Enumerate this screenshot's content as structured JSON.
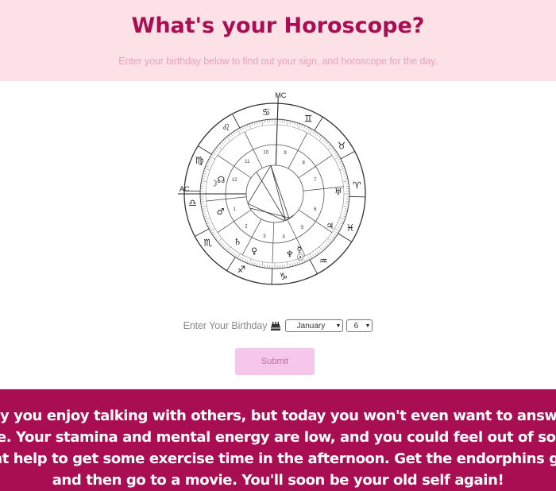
{
  "header": {
    "title": "What's your Horoscope?",
    "subtitle": "Enter your birthday below to find out your sign, and horoscope for the day."
  },
  "chart": {
    "angle_labels": [
      "MC",
      "AC"
    ],
    "house_numbers": [
      "1",
      "2",
      "3",
      "4",
      "5",
      "6",
      "7",
      "8",
      "9",
      "10",
      "11",
      "12"
    ],
    "sign_glyphs": [
      "♋",
      "♊",
      "♉",
      "♈",
      "♓",
      "♒",
      "♑",
      "♐",
      "♏",
      "♎",
      "♍",
      "♌"
    ],
    "planet_glyphs": [
      "☽",
      "☊",
      "♂",
      "♀",
      "♄",
      "♆",
      "☉",
      "☿",
      "♅",
      "♃"
    ]
  },
  "form": {
    "label": "Enter Your Birthday",
    "icon": "cake-icon",
    "month_value": "January",
    "day_value": "6",
    "submit_label": "Submit"
  },
  "horoscope": {
    "text": "Usually you enjoy talking with others, but today you won't even want to answer the phone. Your stamina and mental energy are low, and you could feel out of sorts. It might help to get some exercise time in the afternoon. Get the endorphins going and then go to a movie. You'll soon be your old self again!"
  },
  "colors": {
    "brand": "#a90e53",
    "header_bg": "#fce1e6",
    "subtitle": "#e9a3bc",
    "button_bg": "#f6c7ea",
    "button_text": "#c76aa4"
  }
}
